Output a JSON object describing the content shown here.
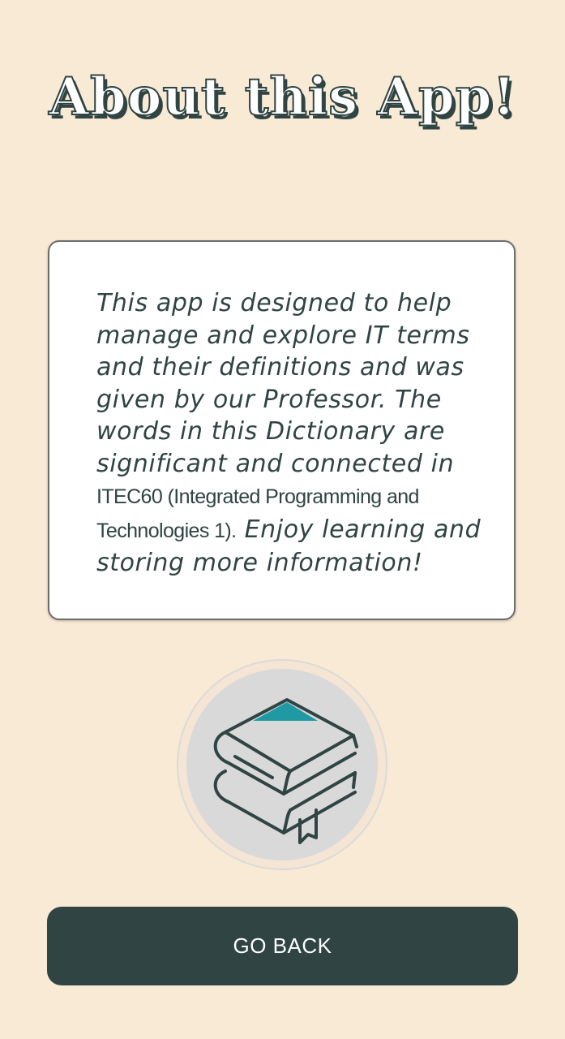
{
  "header": {
    "title": "About this App!"
  },
  "about_card": {
    "text_italic_1": "This app is designed to help manage and explore IT terms and their definitions and was given by our Professor. The words in this Dictionary are significant and connected in ",
    "course_text": "ITEC60 (Integrated Programming and Technologies 1).",
    "text_italic_2": " Enjoy learning and storing more information!"
  },
  "logo": {
    "icon": "books-stack-icon"
  },
  "actions": {
    "back_label": "GO BACK"
  },
  "colors": {
    "background": "#f9ead6",
    "primary_dark": "#2f4443",
    "accent_teal": "#1f9aa5",
    "card": "#ffffff"
  }
}
